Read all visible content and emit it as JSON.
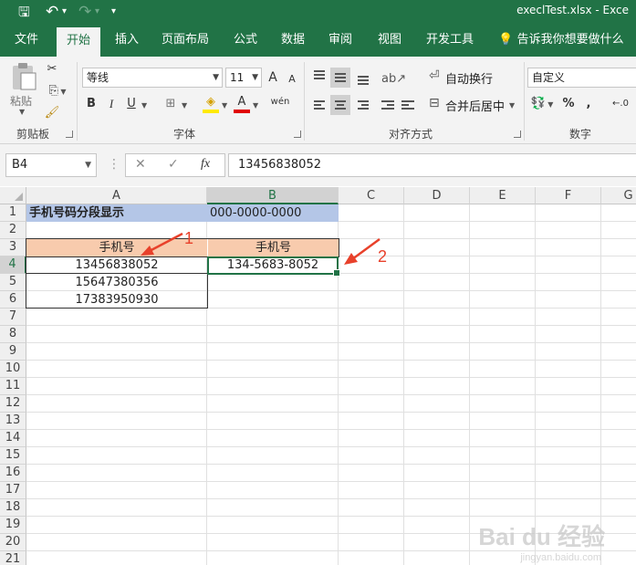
{
  "window": {
    "title": "execlTest.xlsx  -  Exce",
    "qa_save": "🖫",
    "qa_undo": "↶",
    "qa_undo_dd": "▾",
    "qa_redo": "↷",
    "qa_redo_dd": "▾",
    "qa_customize": "▾"
  },
  "tabs": [
    "文件",
    "开始",
    "插入",
    "页面布局",
    "公式",
    "数据",
    "审阅",
    "视图",
    "开发工具",
    "告诉我你想要做什么"
  ],
  "ribbon": {
    "clipboard": {
      "label": "剪贴板",
      "paste": "粘贴"
    },
    "font": {
      "label": "字体",
      "name": "等线",
      "size": "11",
      "grow": "A",
      "shrink": "A",
      "bold": "B",
      "italic": "I",
      "underline": "U",
      "border": "⊞",
      "fill": "◈",
      "color": "A",
      "phonetic": "wén"
    },
    "alignment": {
      "label": "对齐方式",
      "wrap": "自动换行",
      "merge": "合并后居中"
    },
    "number": {
      "label": "数字",
      "format": "自定义",
      "percent": "%",
      "comma": ",",
      "decimal": "←.0"
    }
  },
  "formula_bar": {
    "name_box": "B4",
    "cancel": "✕",
    "enter": "✓",
    "fx": "fx",
    "value": "13456838052"
  },
  "columns": [
    "A",
    "B",
    "C",
    "D",
    "E",
    "F",
    "G"
  ],
  "rows": [
    "1",
    "2",
    "3",
    "4",
    "5",
    "6",
    "7",
    "8",
    "9",
    "10",
    "11",
    "12",
    "13",
    "14",
    "15",
    "16",
    "17",
    "18",
    "19",
    "20",
    "21"
  ],
  "cells": {
    "A1": "手机号码分段显示",
    "B1": "000-0000-0000",
    "A3": "手机号",
    "B3": "手机号",
    "A4": "13456838052",
    "B4": "134-5683-8052",
    "A5": "15647380356",
    "A6": "17383950930"
  },
  "annotations": {
    "one": "1",
    "two": "2"
  },
  "watermark": {
    "main": "Bai du 经验",
    "sub": "jingyan.baidu.com"
  },
  "colors": {
    "accent": "#217346",
    "header_blue": "#b4c6e7",
    "header_peach": "#f8cbad",
    "arrow_red": "#e8412b"
  }
}
